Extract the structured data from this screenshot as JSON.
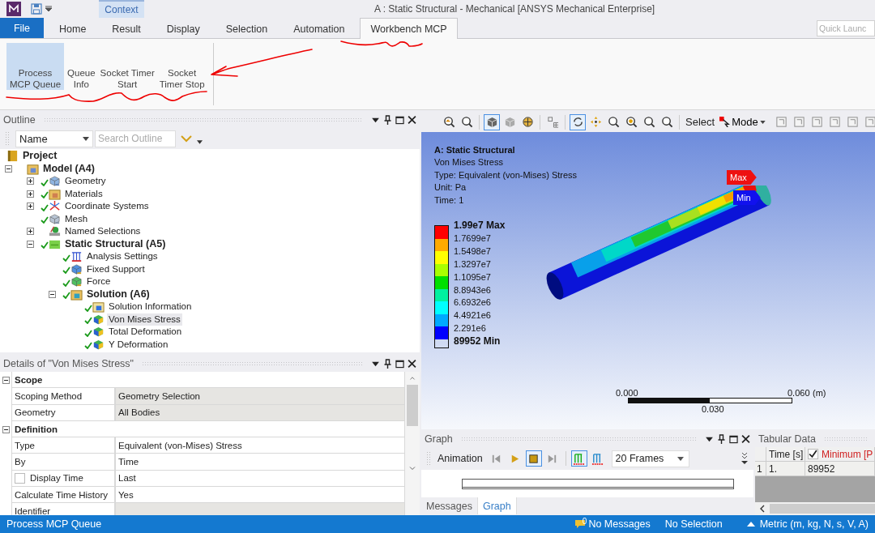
{
  "title_bar": {
    "context_tab": "Context",
    "title": "A : Static Structural - Mechanical [ANSYS Mechanical Enterprise]"
  },
  "ribbon": {
    "tabs": [
      {
        "label": "File",
        "kind": "file",
        "selected": false
      },
      {
        "label": "Home",
        "kind": "tab",
        "selected": false
      },
      {
        "label": "Result",
        "kind": "tab",
        "selected": false
      },
      {
        "label": "Display",
        "kind": "tab",
        "selected": false
      },
      {
        "label": "Selection",
        "kind": "tab",
        "selected": false
      },
      {
        "label": "Automation",
        "kind": "tab",
        "selected": false
      },
      {
        "label": "Workbench MCP",
        "kind": "tab",
        "selected": true
      }
    ],
    "quick_launch": {
      "placeholder": "Quick Launc"
    },
    "buttons": [
      {
        "lines": [
          "Process",
          "MCP Queue"
        ],
        "selected": true
      },
      {
        "lines": [
          "Queue",
          "Info"
        ],
        "selected": false
      },
      {
        "lines": [
          "Socket Timer",
          "Start"
        ],
        "selected": false
      },
      {
        "lines": [
          "Socket",
          "Timer Stop"
        ],
        "selected": false
      }
    ]
  },
  "outline": {
    "title": "Outline",
    "filter": {
      "value": "Name"
    },
    "search": {
      "placeholder": "Search Outline"
    },
    "tree": [
      {
        "label": "Project",
        "kind": "project",
        "bold": true,
        "checked": false,
        "selected": false,
        "children": [
          {
            "label": "Model (A4)",
            "kind": "model",
            "bold": true,
            "checked": false,
            "expanded": true,
            "selected": false,
            "children": [
              {
                "label": "Geometry",
                "kind": "geometry",
                "bold": false,
                "checked": true,
                "expanded": false,
                "selected": false
              },
              {
                "label": "Materials",
                "kind": "materials",
                "bold": false,
                "checked": true,
                "expanded": false,
                "selected": false
              },
              {
                "label": "Coordinate Systems",
                "kind": "coordinates",
                "bold": false,
                "checked": true,
                "expanded": false,
                "selected": false
              },
              {
                "label": "Mesh",
                "kind": "mesh",
                "bold": false,
                "checked": true,
                "selected": false
              },
              {
                "label": "Named Selections",
                "kind": "selections",
                "bold": false,
                "checked": false,
                "expanded": false,
                "selected": false
              },
              {
                "label": "Static Structural (A5)",
                "kind": "environment",
                "bold": true,
                "checked": true,
                "expanded": true,
                "selected": false,
                "children": [
                  {
                    "label": "Analysis Settings",
                    "kind": "settings",
                    "bold": false,
                    "checked": true,
                    "selected": false
                  },
                  {
                    "label": "Fixed Support",
                    "kind": "support",
                    "bold": false,
                    "checked": true,
                    "selected": false
                  },
                  {
                    "label": "Force",
                    "kind": "force",
                    "bold": false,
                    "checked": true,
                    "selected": false
                  },
                  {
                    "label": "Solution (A6)",
                    "kind": "solution",
                    "bold": true,
                    "checked": true,
                    "expanded": true,
                    "selected": false,
                    "children": [
                      {
                        "label": "Solution Information",
                        "kind": "info",
                        "bold": false,
                        "checked": true,
                        "selected": false
                      },
                      {
                        "label": "Von Mises Stress",
                        "kind": "result",
                        "bold": false,
                        "checked": true,
                        "selected": true
                      },
                      {
                        "label": "Total Deformation",
                        "kind": "result",
                        "bold": false,
                        "checked": true,
                        "selected": false
                      },
                      {
                        "label": "Y Deformation",
                        "kind": "result",
                        "bold": false,
                        "checked": true,
                        "selected": false
                      }
                    ]
                  }
                ]
              }
            ]
          }
        ]
      }
    ]
  },
  "details": {
    "title": "Details of \"Von Mises Stress\"",
    "sections": [
      {
        "title": "Scope",
        "expanded": true,
        "rows": [
          {
            "name": "Scoping Method",
            "value": "Geometry Selection",
            "shaded": true,
            "kind": "text"
          },
          {
            "name": "Geometry",
            "value": "All Bodies",
            "shaded": true,
            "kind": "text"
          }
        ]
      },
      {
        "title": "Definition",
        "expanded": true,
        "rows": [
          {
            "name": "Type",
            "value": "Equivalent (von-Mises) Stress",
            "shaded": false,
            "kind": "text"
          },
          {
            "name": "By",
            "value": "Time",
            "shaded": false,
            "kind": "text"
          },
          {
            "name": "Display Time",
            "value": "Last",
            "shaded": false,
            "kind": "checkbox",
            "checked": false
          },
          {
            "name": "Calculate Time History",
            "value": "Yes",
            "shaded": false,
            "kind": "text"
          },
          {
            "name": "Identifier",
            "shaded": true,
            "kind": "text"
          }
        ]
      }
    ]
  },
  "view_toolbar": {
    "items": [
      {
        "kind": "icon",
        "selected": false
      },
      {
        "kind": "icon",
        "selected": false
      },
      {
        "kind": "separator"
      },
      {
        "kind": "icon",
        "selected": true
      },
      {
        "kind": "icon",
        "selected": false
      },
      {
        "kind": "icon",
        "selected": false
      },
      {
        "kind": "separator"
      },
      {
        "kind": "icon",
        "selected": false
      },
      {
        "kind": "separator"
      },
      {
        "kind": "icon",
        "selected": true
      },
      {
        "kind": "icon",
        "selected": false
      },
      {
        "kind": "icon",
        "selected": false
      },
      {
        "kind": "icon",
        "selected": false
      },
      {
        "kind": "icon",
        "selected": false
      },
      {
        "kind": "icon",
        "selected": false
      },
      {
        "kind": "separator"
      },
      {
        "kind": "label",
        "label": "Select"
      },
      {
        "kind": "menu",
        "label": "Mode"
      },
      {
        "kind": "icon",
        "selected": false
      },
      {
        "kind": "icon",
        "selected": false
      },
      {
        "kind": "icon",
        "selected": false
      },
      {
        "kind": "icon",
        "selected": false
      },
      {
        "kind": "icon",
        "selected": false
      },
      {
        "kind": "icon",
        "selected": false
      }
    ]
  },
  "viewport": {
    "info": [
      {
        "text": "A: Static Structural",
        "bold": true
      },
      {
        "text": "Von Mises Stress",
        "bold": false
      },
      {
        "text": "Type: Equivalent (von-Mises) Stress",
        "bold": false
      },
      {
        "text": "Unit: Pa",
        "bold": false
      },
      {
        "text": "Time: 1",
        "bold": false
      }
    ],
    "legend": {
      "bands": [
        {
          "color": "#ff0000"
        },
        {
          "color": "#ffaa00"
        },
        {
          "color": "#ffff00"
        },
        {
          "color": "#aaff00"
        },
        {
          "color": "#00e000"
        },
        {
          "color": "#00f0a0"
        },
        {
          "color": "#00ffff"
        },
        {
          "color": "#00aaff"
        },
        {
          "color": "#0000ff"
        }
      ],
      "labels": [
        "1.99e7 Max",
        "1.7699e7",
        "1.5498e7",
        "1.3297e7",
        "1.1095e7",
        "8.8943e6",
        "6.6932e6",
        "4.4921e6",
        "2.291e6",
        "89952 Min"
      ]
    },
    "probes": [
      {
        "label": "Max",
        "color": "#ee1111"
      },
      {
        "label": "Min",
        "color": "#1111ee"
      }
    ],
    "scale": {
      "start": "0.000",
      "end": "0.060",
      "unit": "(m)",
      "middle": "0.030"
    }
  },
  "graph": {
    "title": "Graph",
    "animation_label": "Animation",
    "controls": [
      {
        "kind": "first",
        "selected": false
      },
      {
        "kind": "play",
        "selected": false
      },
      {
        "kind": "stop",
        "selected": true
      },
      {
        "kind": "last",
        "selected": false
      },
      {
        "kind": "separator"
      },
      {
        "kind": "bars",
        "selected": true
      },
      {
        "kind": "bars-blue",
        "selected": false
      }
    ],
    "frames": {
      "value": "20 Frames"
    },
    "tabs": [
      {
        "label": "Messages",
        "selected": false
      },
      {
        "label": "Graph",
        "selected": true
      }
    ]
  },
  "tabular": {
    "title": "Tabular Data",
    "columns": [
      {
        "label": "Time [s]",
        "kind": "text"
      },
      {
        "label": "Minimum [P",
        "kind": "checkbox",
        "checked": true
      }
    ],
    "rows": [
      {
        "index": "1",
        "cells": [
          "1.",
          "89952"
        ]
      }
    ]
  },
  "status_bar": {
    "left": "Process MCP Queue",
    "message_count": "0",
    "messages": "No Messages",
    "selection": "No Selection",
    "units": "Metric (m, kg, N, s, V, A)"
  }
}
